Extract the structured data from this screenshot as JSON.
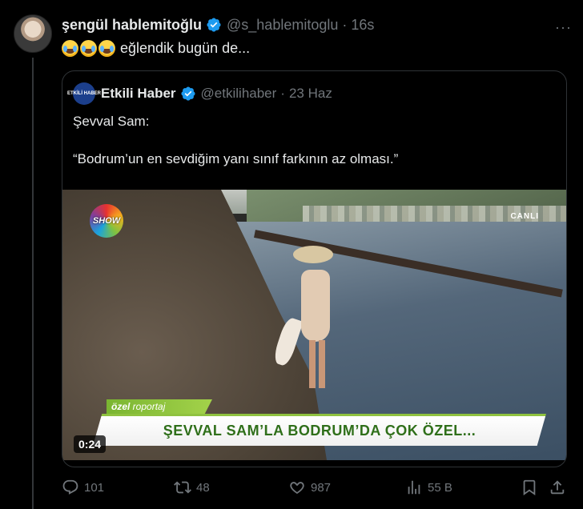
{
  "tweet": {
    "author_name": "şengül hablemitoğlu",
    "author_handle": "@s_hablemitoglu",
    "separator": "·",
    "time": "16s",
    "text": "eğlendik bugün de...",
    "emoji_name": "face-with-tears-of-joy",
    "emoji_count": 3
  },
  "quote": {
    "author_name": "Etkili Haber",
    "author_avatar_text": "ETKİLİ HABER",
    "author_handle": "@etkilihaber",
    "separator": "·",
    "time": "23 Haz",
    "line1": "Şevval Sam:",
    "line2": "“Bodrum’un en sevdiğim yanı sınıf farkının az olması.”",
    "video": {
      "channel_logo": "SHOW",
      "live_label": "CANLI",
      "tag_bold": "özel",
      "tag_rest": " roportaj",
      "banner": "ŞEVVAL SAM’LA BODRUM’DA ÇOK ÖZEL...",
      "duration": "0:24"
    }
  },
  "actions": {
    "replies": "101",
    "reposts": "48",
    "likes": "987",
    "views": "55 B"
  },
  "colors": {
    "background": "#000000",
    "text": "#e7e9ea",
    "muted": "#71767b",
    "verified": "#1d9bf0",
    "border": "#2f3336"
  }
}
